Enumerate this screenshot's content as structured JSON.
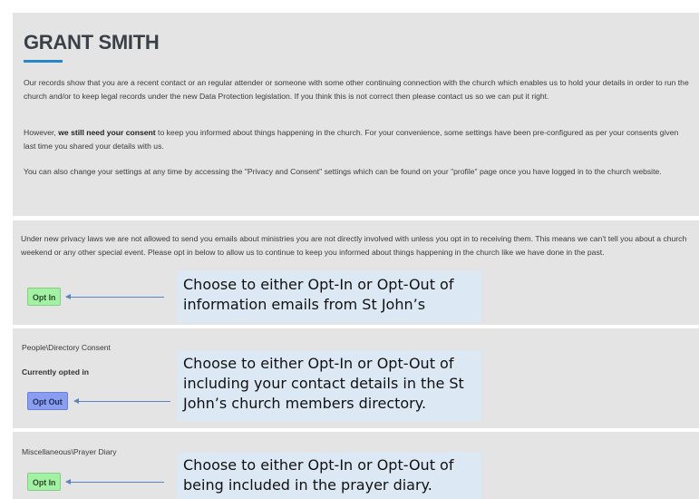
{
  "header": {
    "title": "GRANT SMITH",
    "para1": "Our records show that you are a recent contact or an regular attender or someone with some other continuing connection with the church which enables us to hold your details in order to run the church and/or to keep legal records under the new Data Protection legislation. If you think this is not correct then please contact us so we can put it right.",
    "para2_prefix": "However, ",
    "para2_bold": "we still need your consent",
    "para2_suffix": " to keep you informed about things happening in the church. For your convenience, some settings have been pre-configured as per your consents given last time you shared your details with us.",
    "para3": "You can also change your settings at any time by accessing the \"Privacy and Consent\" settings which can be found on your \"profile\" page once you have logged in to the church website."
  },
  "email_section": {
    "text": "Under new privacy laws we are not allowed to send you emails about ministries you are not directly involved with unless you opt in to receiving them. This means we can't tell you about a church weekend or any other special event. Please opt in below to allow us to continue to keep you informed about things happening in the church like we have done in the past.",
    "button_label": "Opt In",
    "callout": "Choose to either Opt-In or Opt-Out of information emails from St John’s"
  },
  "directory_section": {
    "label": "People\\Directory Consent",
    "status": "Currently opted in",
    "button_label": "Opt Out",
    "callout": "Choose to either Opt-In or Opt-Out of including your contact details in the St John’s church members directory."
  },
  "prayer_section": {
    "label": "Miscellaneous\\Prayer Diary",
    "button_label": "Opt In",
    "callout": "Choose to either Opt-In or Opt-Out of being included in the prayer diary."
  },
  "colors": {
    "panel_bg": "#e4e4e4",
    "accent_underline": "#2b86c5",
    "opt_in_green": "#a3f2a3",
    "opt_out_blue": "#8a9ef0",
    "callout_bg": "#dde8f5",
    "arrow": "#5b84c4"
  },
  "icons": {
    "pointer": "arrow-left-icon"
  }
}
